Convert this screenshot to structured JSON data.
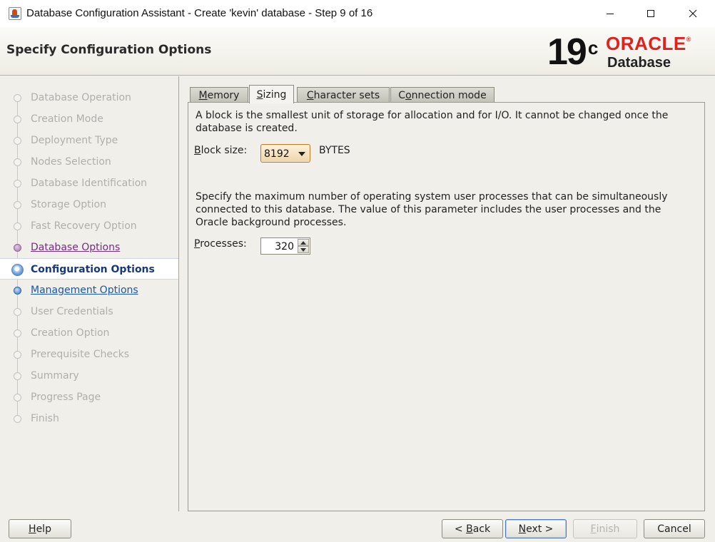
{
  "window": {
    "title": "Database Configuration Assistant - Create 'kevin' database - Step 9 of 16"
  },
  "header": {
    "page_title": "Specify Configuration Options",
    "logo_version": "19",
    "logo_version_suffix": "c",
    "logo_brand": "ORACLE",
    "logo_brand_trademark": "®",
    "logo_product": "Database"
  },
  "steps": [
    {
      "label": "Database Operation",
      "state": "disabled"
    },
    {
      "label": "Creation Mode",
      "state": "disabled"
    },
    {
      "label": "Deployment Type",
      "state": "disabled"
    },
    {
      "label": "Nodes Selection",
      "state": "disabled"
    },
    {
      "label": "Database Identification",
      "state": "disabled"
    },
    {
      "label": "Storage Option",
      "state": "disabled"
    },
    {
      "label": "Fast Recovery Option",
      "state": "disabled"
    },
    {
      "label": "Database Options",
      "state": "visited"
    },
    {
      "label": "Configuration Options",
      "state": "current"
    },
    {
      "label": "Management Options",
      "state": "next"
    },
    {
      "label": "User Credentials",
      "state": "disabled"
    },
    {
      "label": "Creation Option",
      "state": "disabled"
    },
    {
      "label": "Prerequisite Checks",
      "state": "disabled"
    },
    {
      "label": "Summary",
      "state": "disabled"
    },
    {
      "label": "Progress Page",
      "state": "disabled"
    },
    {
      "label": "Finish",
      "state": "disabled"
    }
  ],
  "tabs": [
    {
      "label": "Memory",
      "mnemonic": "M",
      "rest": "emory",
      "active": false
    },
    {
      "label": "Sizing",
      "mnemonic": "S",
      "rest": "izing",
      "active": true
    },
    {
      "label": "Character sets",
      "mnemonic": "C",
      "rest": "haracter sets",
      "active": false
    },
    {
      "label": "Connection mode",
      "mnemonic": "o",
      "prefix": "C",
      "rest": "nnection mode",
      "active": false
    }
  ],
  "sizing": {
    "block_description": "A block is the smallest unit of storage for allocation and for I/O. It cannot be changed once the database is created.",
    "block_size_label": "Block size:",
    "block_size_label_mnemonic": "B",
    "block_size_label_rest": "lock size:",
    "block_size_value": "8192",
    "block_size_unit": "BYTES",
    "processes_description": "Specify the maximum number of operating system user processes that can be simultaneously connected to this database. The value of this parameter includes the user processes and the Oracle background processes.",
    "processes_label": "Processes:",
    "processes_label_mnemonic": "P",
    "processes_label_rest": "rocesses:",
    "processes_value": "320"
  },
  "buttons": {
    "help": {
      "label": "Help",
      "mnemonic": "H",
      "rest": "elp"
    },
    "back": {
      "label": "< Back",
      "prefix": "< ",
      "mnemonic": "B",
      "rest": "ack"
    },
    "next": {
      "label": "Next >",
      "mnemonic": "N",
      "rest": "ext >"
    },
    "finish": {
      "label": "Finish",
      "mnemonic": "F",
      "rest": "inish",
      "enabled": false
    },
    "cancel": {
      "label": "Cancel"
    }
  },
  "colors": {
    "oracle_red": "#e2201c",
    "current_step": "#17387a",
    "visited_step": "#7a2a86",
    "next_step": "#1c56ad"
  }
}
